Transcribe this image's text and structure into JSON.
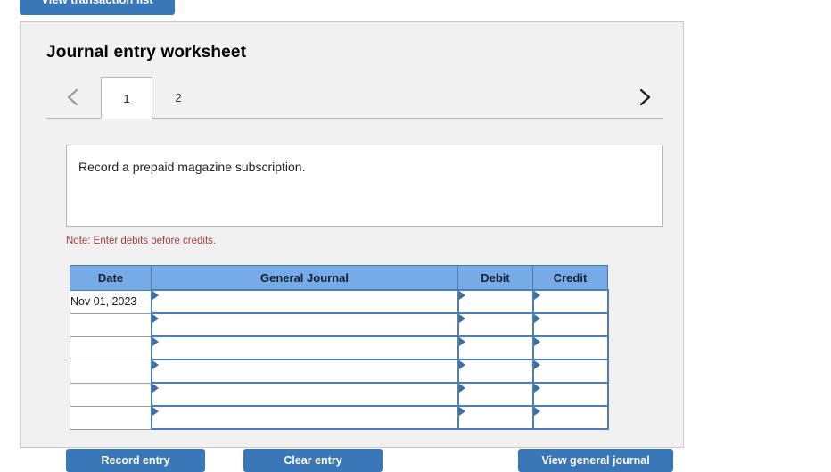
{
  "toolbar": {
    "view_transaction_list_label": "View transaction list"
  },
  "worksheet": {
    "title": "Journal entry worksheet",
    "pager": {
      "prev_icon": "chevron-left-icon",
      "next_icon": "chevron-right-icon",
      "tabs": [
        {
          "label": "1",
          "active": true
        },
        {
          "label": "2",
          "active": false
        }
      ]
    },
    "instruction": "Record a prepaid magazine subscription.",
    "note": "Note: Enter debits before credits.",
    "table": {
      "columns": [
        "Date",
        "General Journal",
        "Debit",
        "Credit"
      ],
      "rows": [
        {
          "date": "Nov 01, 2023",
          "journal": "",
          "debit": "",
          "credit": ""
        },
        {
          "date": "",
          "journal": "",
          "debit": "",
          "credit": ""
        },
        {
          "date": "",
          "journal": "",
          "debit": "",
          "credit": ""
        },
        {
          "date": "",
          "journal": "",
          "debit": "",
          "credit": ""
        },
        {
          "date": "",
          "journal": "",
          "debit": "",
          "credit": ""
        },
        {
          "date": "",
          "journal": "",
          "debit": "",
          "credit": ""
        }
      ]
    },
    "actions": {
      "record_entry_label": "Record entry",
      "clear_entry_label": "Clear entry",
      "view_general_journal_label": "View general journal"
    }
  },
  "colors": {
    "button_blue": "#3a77b9",
    "table_header_blue": "#76abe8",
    "cell_border_blue": "#4a7fb5",
    "note_red": "#a63a41",
    "panel_gray": "#f1f1f1"
  }
}
